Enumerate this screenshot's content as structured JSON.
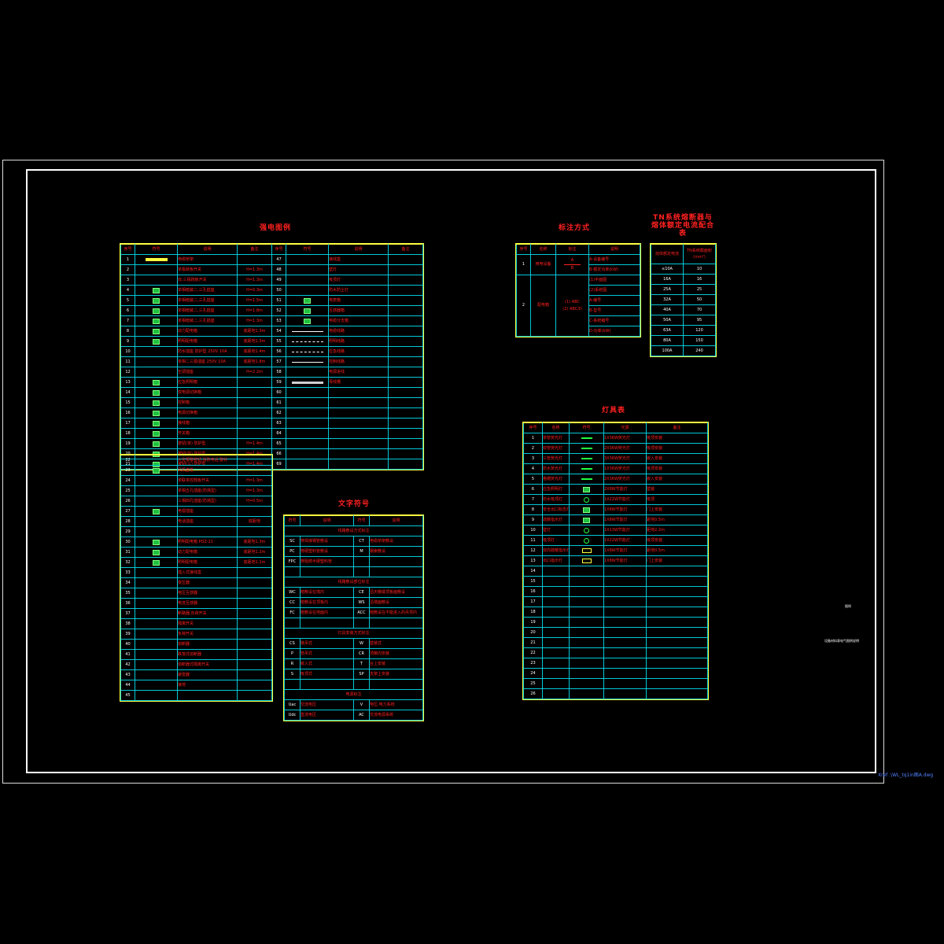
{
  "drawing": {
    "xref": "Xref .\\WL_tq1in图A.dwg",
    "side_note_1": "图例",
    "side_note_2": "设备材料表电气图例说明"
  },
  "legend_table": {
    "title": "强电图例",
    "headers": [
      "序号",
      "符号",
      "说明",
      "备注",
      "序号",
      "符号",
      "说明",
      "备注"
    ],
    "left_rows": [
      {
        "no": "1",
        "symbol": "dots",
        "desc": "电缆桥架",
        "note": ""
      },
      {
        "no": "2",
        "symbol": "",
        "desc": "单极跷板开关",
        "note": "H=1.3m"
      },
      {
        "no": "3",
        "symbol": "",
        "desc": "双,三极跷板开关",
        "note": "H=1.3m"
      },
      {
        "no": "4",
        "symbol": "box",
        "desc": "单相暗装二,三孔插座",
        "note": "H=0.3m"
      },
      {
        "no": "5",
        "symbol": "box",
        "desc": "单相暗装二,三孔插座",
        "note": "H=1.5m"
      },
      {
        "no": "6",
        "symbol": "box",
        "desc": "单相暗装二,三孔插座",
        "note": "H=1.8m"
      },
      {
        "no": "7",
        "symbol": "box",
        "desc": "单相暗装二,三孔插座",
        "note": "H=1.3m"
      },
      {
        "no": "8",
        "symbol": "box",
        "desc": "动力配电箱",
        "note": "底距地1.3m"
      },
      {
        "no": "9",
        "symbol": "box",
        "desc": "照明配电箱",
        "note": "底距地1.3m"
      },
      {
        "no": "10",
        "symbol": "",
        "desc": "防水插座 防护型 250V 10A",
        "note": "底距地1.4m"
      },
      {
        "no": "11",
        "symbol": "",
        "desc": "单相二三极插座 250V 10A",
        "note": "底距地1.8m"
      },
      {
        "no": "12",
        "symbol": "",
        "desc": "空调插座",
        "note": "H=2.2m"
      },
      {
        "no": "13",
        "symbol": "box",
        "desc": "应急照明箱",
        "note": ""
      },
      {
        "no": "14",
        "symbol": "box",
        "desc": "双电源切换箱",
        "note": ""
      },
      {
        "no": "15",
        "symbol": "box",
        "desc": "控制箱",
        "note": ""
      },
      {
        "no": "16",
        "symbol": "box",
        "desc": "电源切换箱",
        "note": ""
      },
      {
        "no": "17",
        "symbol": "box",
        "desc": "接线箱",
        "note": ""
      },
      {
        "no": "18",
        "symbol": "box",
        "desc": "开关箱",
        "note": ""
      },
      {
        "no": "19",
        "symbol": "box",
        "desc": "按钮(单) 防护型",
        "note": "H=1.4m"
      },
      {
        "no": "20",
        "symbol": "box",
        "desc": "按钮(双) 防护型",
        "note": "H=1.4m"
      },
      {
        "no": "21",
        "symbol": "box",
        "desc": "按钮(三) 防护型",
        "note": "H=1.4m"
      }
    ],
    "right_rows": [
      {
        "no": "47",
        "symbol": "",
        "desc": "接线盒",
        "note": ""
      },
      {
        "no": "48",
        "symbol": "",
        "desc": "壁灯",
        "note": ""
      },
      {
        "no": "49",
        "symbol": "",
        "desc": "吸顶灯",
        "note": ""
      },
      {
        "no": "50",
        "symbol": "",
        "desc": "防水防尘灯",
        "note": ""
      },
      {
        "no": "51",
        "symbol": "box",
        "desc": "电表箱",
        "note": ""
      },
      {
        "no": "52",
        "symbol": "box",
        "desc": "互感器箱",
        "note": ""
      },
      {
        "no": "53",
        "symbol": "box",
        "desc": "电缆分支箱",
        "note": ""
      },
      {
        "no": "54",
        "symbol": "line",
        "desc": "电缆线路",
        "note": ""
      },
      {
        "no": "55",
        "symbol": "dash",
        "desc": "照明线路",
        "note": ""
      },
      {
        "no": "56",
        "symbol": "dash",
        "desc": "应急线路",
        "note": ""
      },
      {
        "no": "57",
        "symbol": "line",
        "desc": "控制线路",
        "note": ""
      },
      {
        "no": "58",
        "symbol": "",
        "desc": "电源进线",
        "note": ""
      },
      {
        "no": "59",
        "symbol": "thick",
        "desc": "母线槽",
        "note": ""
      },
      {
        "no": "60",
        "symbol": "",
        "desc": "",
        "note": ""
      },
      {
        "no": "61",
        "symbol": "",
        "desc": "",
        "note": ""
      },
      {
        "no": "62",
        "symbol": "",
        "desc": "",
        "note": ""
      },
      {
        "no": "63",
        "symbol": "",
        "desc": "",
        "note": ""
      },
      {
        "no": "64",
        "symbol": "",
        "desc": "",
        "note": ""
      },
      {
        "no": "65",
        "symbol": "",
        "desc": "",
        "note": ""
      },
      {
        "no": "66",
        "symbol": "",
        "desc": "",
        "note": ""
      },
      {
        "no": "69",
        "symbol": "",
        "desc": "",
        "note": ""
      }
    ],
    "lower_rows": [
      {
        "no": "22",
        "symbol": "",
        "desc": "火灾报警按钮,消防电话,警铃",
        "note": ""
      },
      {
        "no": "23",
        "symbol": "box",
        "desc": "风机盘管",
        "note": ""
      },
      {
        "no": "24",
        "symbol": "",
        "desc": "单联单控翘板开关",
        "note": "H=1.3m"
      },
      {
        "no": "25",
        "symbol": "",
        "desc": "单相五孔插座(防溅型)",
        "note": "H=1.3m"
      },
      {
        "no": "26",
        "symbol": "",
        "desc": "三相四孔插座(防溅型)",
        "note": "H=0.5m"
      },
      {
        "no": "27",
        "symbol": "box",
        "desc": "电视插座",
        "note": ""
      },
      {
        "no": "28",
        "symbol": "",
        "desc": "电话插座",
        "note": "底距地"
      },
      {
        "no": "29",
        "symbol": "",
        "desc": "",
        "note": ""
      },
      {
        "no": "30",
        "symbol": "box",
        "desc": "照明配电箱 PDZ-21",
        "note": "底距地1.3m"
      },
      {
        "no": "31",
        "symbol": "box",
        "desc": "动力配电箱",
        "note": "底距地1.2m"
      },
      {
        "no": "32",
        "symbol": "box",
        "desc": "照明配电箱",
        "note": "底距地1.1m"
      },
      {
        "no": "33",
        "symbol": "",
        "desc": "插入式接线盒",
        "note": ""
      },
      {
        "no": "34",
        "symbol": "",
        "desc": "变压器",
        "note": ""
      },
      {
        "no": "35",
        "symbol": "",
        "desc": "电压互感器",
        "note": ""
      },
      {
        "no": "36",
        "symbol": "",
        "desc": "电流互感器",
        "note": ""
      },
      {
        "no": "37",
        "symbol": "",
        "desc": "断路器,负荷开关",
        "note": ""
      },
      {
        "no": "38",
        "symbol": "",
        "desc": "隔离开关",
        "note": ""
      },
      {
        "no": "39",
        "symbol": "",
        "desc": "负荷开关",
        "note": ""
      },
      {
        "no": "40",
        "symbol": "",
        "desc": "熔断器",
        "note": ""
      },
      {
        "no": "41",
        "symbol": "",
        "desc": "跌落式熔断器",
        "note": ""
      },
      {
        "no": "42",
        "symbol": "",
        "desc": "熔断器式隔离开关",
        "note": ""
      },
      {
        "no": "43",
        "symbol": "",
        "desc": "避雷器",
        "note": ""
      },
      {
        "no": "44",
        "symbol": "",
        "desc": "接地",
        "note": ""
      },
      {
        "no": "45",
        "symbol": "",
        "desc": "",
        "note": ""
      }
    ]
  },
  "text_symbols": {
    "title": "文字符号",
    "headers": [
      "符号",
      "说明",
      "符号",
      "说明"
    ],
    "groups": [
      {
        "heading": "线路敷设方式标注",
        "rows": [
          [
            "SC",
            "穿焊接钢管敷设",
            "CT",
            "电缆桥架敷设"
          ],
          [
            "PC",
            "穿硬塑料管敷设",
            "M",
            "钢索敷设"
          ],
          [
            "FPC",
            "穿阻燃半硬塑料管",
            "",
            ""
          ]
        ]
      },
      {
        "heading": "线路敷设部位标注",
        "rows": [
          [
            "WC",
            "暗敷设在墙内",
            "CE",
            "沿天棚或顶板面敷设"
          ],
          [
            "CC",
            "暗敷设在顶板内",
            "WS",
            "沿墙面敷设"
          ],
          [
            "FC",
            "暗敷设在地面内",
            "ACC",
            "暗敷设在不能进入的吊顶内"
          ]
        ]
      },
      {
        "heading": "灯具安装方式标注",
        "rows": [
          [
            "CS",
            "链吊式",
            "W",
            "壁装式"
          ],
          [
            "P",
            "管吊式",
            "CR",
            "顶棚内安装"
          ],
          [
            "R",
            "嵌入式",
            "T",
            "台上安装"
          ],
          [
            "S",
            "吸顶式",
            "SP",
            "支架上安装"
          ]
        ]
      },
      {
        "heading": "电源标注",
        "rows": [
          [
            "Uac",
            "交流电压",
            "V",
            "电压,电力系统"
          ],
          [
            "Udc",
            "直流电压",
            "AC",
            "交流电源系统"
          ]
        ]
      }
    ]
  },
  "marking_method": {
    "title": "标注方式",
    "headers": [
      "序号",
      "名称",
      "标注",
      "说明"
    ],
    "rows": [
      {
        "no": "1",
        "name": "用电设备",
        "mark_top": "A",
        "mark_bottom": "B",
        "lines": [
          "A-设备编号",
          "B-额定功率(kW)"
        ]
      },
      {
        "no": "2",
        "name": "配电箱",
        "mark_top": "(1) ABC",
        "mark_bottom": "(2) ABC/D",
        "lines": [
          "(1)平面图",
          "(2)系统图",
          "A-编号",
          "B-型号",
          "C-系统编号",
          "D-功率(kW)"
        ]
      }
    ]
  },
  "fuse_table": {
    "title": "TN系统熔断器与\n熔体额定电流配合表",
    "headers": [
      "熔体额定电流",
      "TN系统截面积(mm²)"
    ],
    "rows": [
      [
        "≤10A",
        "10"
      ],
      [
        "16A",
        "16"
      ],
      [
        "25A",
        "25"
      ],
      [
        "32A",
        "50"
      ],
      [
        "40A",
        "70"
      ],
      [
        "50A",
        "95"
      ],
      [
        "63A",
        "120"
      ],
      [
        "80A",
        "150"
      ],
      [
        "100A",
        "240"
      ]
    ]
  },
  "lamp_table": {
    "title": "灯具表",
    "headers": [
      "序号",
      "名称",
      "符号",
      "光源",
      "备注"
    ],
    "rows": [
      [
        "1",
        "单管荧光灯",
        "tube",
        "1X36W荧光灯",
        "吸顶安装"
      ],
      [
        "2",
        "双管荧光灯",
        "tube",
        "2X36W荧光灯",
        "吸顶安装"
      ],
      [
        "3",
        "三管荧光灯",
        "tube",
        "3X36W荧光灯",
        "嵌入安装"
      ],
      [
        "4",
        "防水荧光灯",
        "tube",
        "1X36W荧光灯",
        "吸顶安装"
      ],
      [
        "5",
        "格栅荧光灯",
        "tube",
        "2X36W荧光灯",
        "嵌入安装"
      ],
      [
        "6",
        "应急照明灯",
        "box",
        "2X8W节能灯",
        "壁装"
      ],
      [
        "7",
        "防水吸顶灯",
        "circle",
        "1X22W节能灯",
        "吸顶"
      ],
      [
        "8",
        "安全出口标志灯",
        "box",
        "1X8W节能灯",
        "门上安装"
      ],
      [
        "9",
        "疏散指示灯",
        "box",
        "1X8W节能灯",
        "距地0.5m"
      ],
      [
        "10",
        "壁灯",
        "circle",
        "1X13W节能灯",
        "距地2.2m"
      ],
      [
        "11",
        "吸顶灯",
        "circle",
        "1X22W节能灯",
        "吸顶安装"
      ],
      [
        "12",
        "双向疏散指示灯",
        "rect",
        "1X8W节能灯",
        "距地0.5m"
      ],
      [
        "13",
        "出口指示灯",
        "rect",
        "1X8W节能灯",
        "门上安装"
      ],
      [
        "14",
        "",
        "",
        "",
        ""
      ],
      [
        "15",
        "",
        "",
        "",
        ""
      ],
      [
        "16",
        "",
        "",
        "",
        ""
      ],
      [
        "17",
        "",
        "",
        "",
        ""
      ],
      [
        "18",
        "",
        "",
        "",
        ""
      ],
      [
        "19",
        "",
        "",
        "",
        ""
      ],
      [
        "20",
        "",
        "",
        "",
        ""
      ],
      [
        "21",
        "",
        "",
        "",
        ""
      ],
      [
        "22",
        "",
        "",
        "",
        ""
      ],
      [
        "23",
        "",
        "",
        "",
        ""
      ],
      [
        "24",
        "",
        "",
        "",
        ""
      ],
      [
        "25",
        "",
        "",
        "",
        ""
      ],
      [
        "26",
        "",
        "",
        "",
        ""
      ]
    ]
  }
}
